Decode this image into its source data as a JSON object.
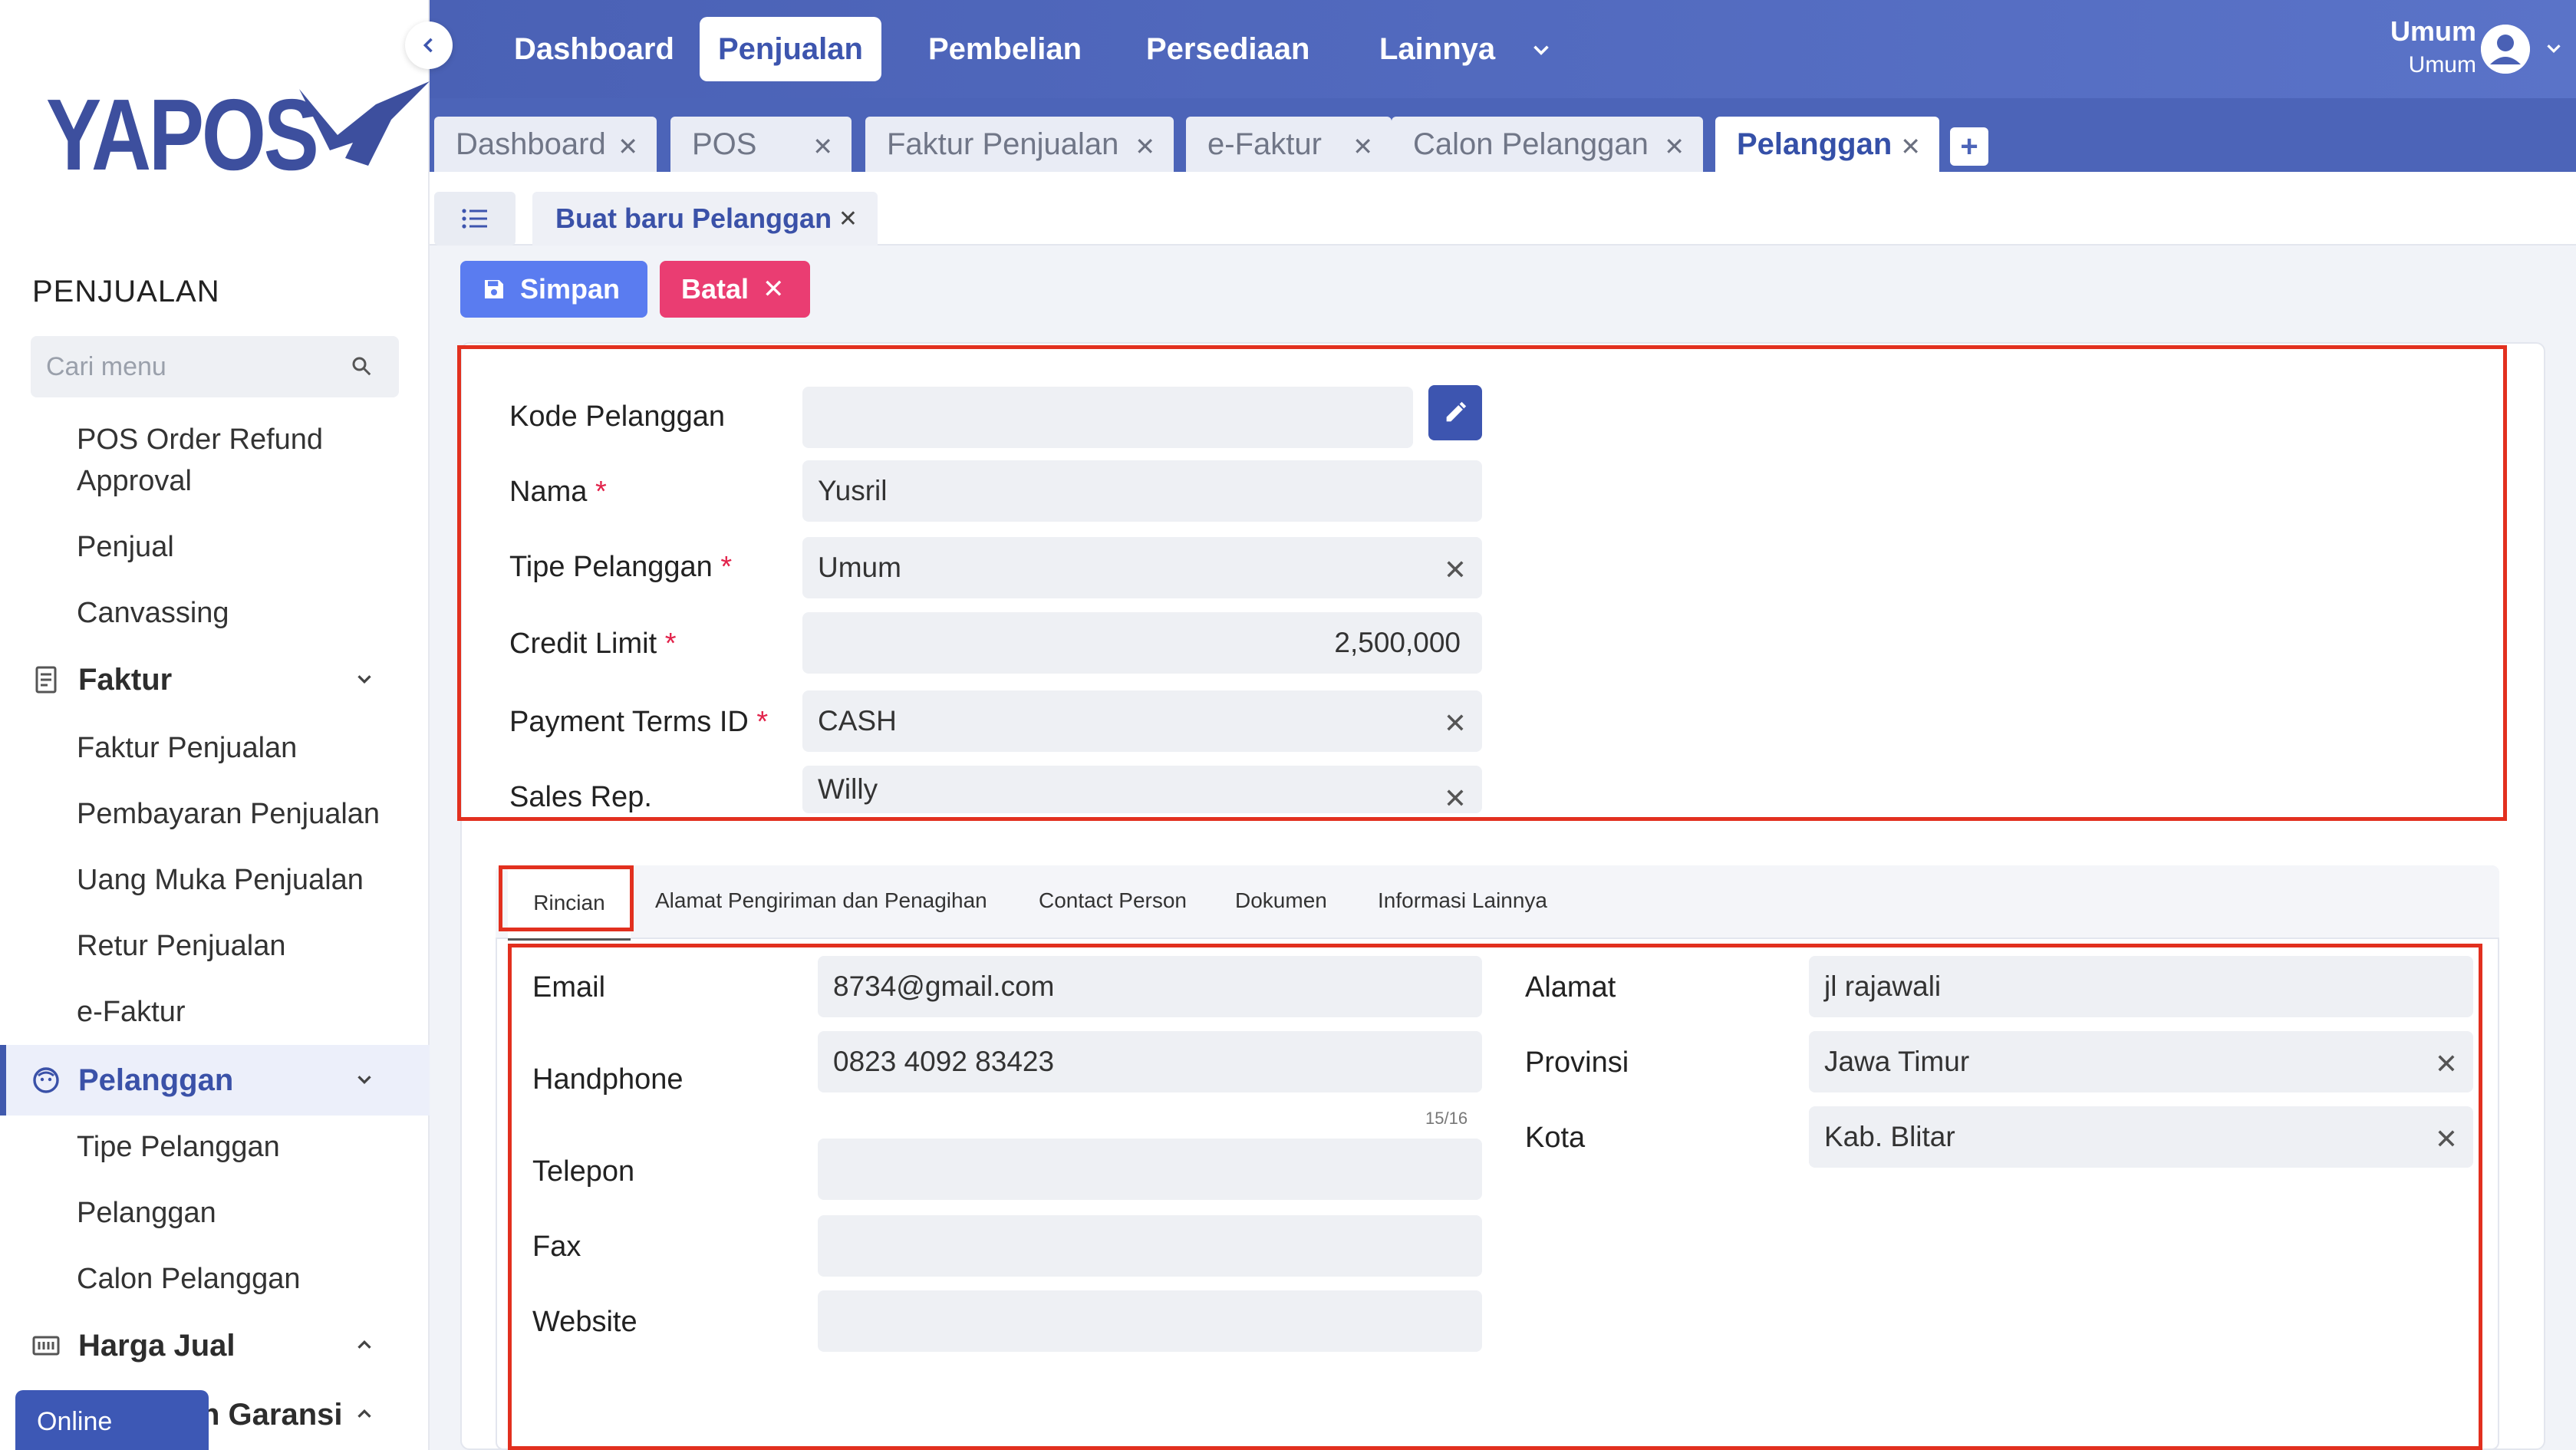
{
  "brand": {
    "name": "YAPOS"
  },
  "sidebar": {
    "section_title": "PENJUALAN",
    "search_placeholder": "Cari menu",
    "items": [
      {
        "label": "POS Order Refund Approval"
      },
      {
        "label": "Penjual"
      },
      {
        "label": "Canvassing"
      }
    ],
    "groups": {
      "faktur": {
        "label": "Faktur",
        "items": [
          "Faktur Penjualan",
          "Pembayaran Penjualan",
          "Uang Muka Penjualan",
          "Retur Penjualan",
          "e-Faktur"
        ]
      },
      "pelanggan": {
        "label": "Pelanggan",
        "items": [
          "Tipe Pelanggan",
          "Pelanggan",
          "Calon Pelanggan"
        ]
      },
      "harga_jual": {
        "label": "Harga Jual"
      },
      "garansi": {
        "label": "n Garansi"
      }
    },
    "online_status": "Online"
  },
  "topnav": {
    "items": [
      "Dashboard",
      "Penjualan",
      "Pembelian",
      "Persediaan",
      "Lainnya"
    ],
    "active": "Penjualan",
    "user": {
      "name": "Umum",
      "role": "Umum"
    }
  },
  "tabs": [
    {
      "label": "Dashboard"
    },
    {
      "label": "POS"
    },
    {
      "label": "Faktur Penjualan"
    },
    {
      "label": "e-Faktur"
    },
    {
      "label": "Calon Pelanggan"
    },
    {
      "label": "Pelanggan",
      "active": true
    }
  ],
  "subtab": {
    "label": "Buat baru Pelanggan"
  },
  "actions": {
    "save": "Simpan",
    "cancel": "Batal"
  },
  "form": {
    "kode_pelanggan": {
      "label": "Kode Pelanggan",
      "value": ""
    },
    "nama": {
      "label": "Nama",
      "value": "Yusril"
    },
    "tipe_pelanggan": {
      "label": "Tipe Pelanggan",
      "value": "Umum"
    },
    "credit_limit": {
      "label": "Credit Limit",
      "value": "2,500,000"
    },
    "payment_terms": {
      "label": "Payment Terms ID",
      "value": "CASH"
    },
    "sales_rep": {
      "label": "Sales Rep.",
      "value": "Willy"
    }
  },
  "inner_tabs": [
    "Rincian",
    "Alamat Pengiriman dan Penagihan",
    "Contact Person",
    "Dokumen",
    "Informasi Lainnya"
  ],
  "details": {
    "email": {
      "label": "Email",
      "value": "8734@gmail.com"
    },
    "handphone": {
      "label": "Handphone",
      "value": "0823 4092 83423",
      "counter": "15/16"
    },
    "telepon": {
      "label": "Telepon",
      "value": ""
    },
    "fax": {
      "label": "Fax",
      "value": ""
    },
    "website": {
      "label": "Website",
      "value": ""
    },
    "alamat": {
      "label": "Alamat",
      "value": "jl rajawali"
    },
    "provinsi": {
      "label": "Provinsi",
      "value": "Jawa Timur"
    },
    "kota": {
      "label": "Kota",
      "value": "Kab. Blitar"
    }
  },
  "colors": {
    "primary": "#4a61b5",
    "accent_save": "#5a7cf0",
    "accent_cancel": "#ea3d72",
    "highlight": "#e2301f"
  }
}
